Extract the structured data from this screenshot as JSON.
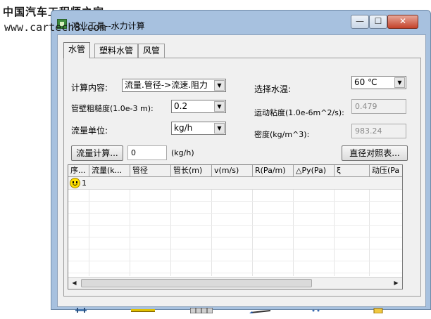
{
  "watermark": {
    "line1": "中国汽车工程师之家",
    "line2": "www.cartech8.com"
  },
  "window": {
    "title": "鸿业工具--水力计算",
    "controls": {
      "minimize": "—",
      "maximize": "☐",
      "close": "✕"
    }
  },
  "tabs": [
    {
      "label": "水管",
      "active": true
    },
    {
      "label": "塑料水管",
      "active": false
    },
    {
      "label": "风管",
      "active": false
    }
  ],
  "form": {
    "calc_content_label": "计算内容:",
    "calc_content_value": "流量.管径->流速.阻力",
    "roughness_label": "管壁粗糙度(1.0e-3 m):",
    "roughness_value": "0.2",
    "flow_unit_label": "流量单位:",
    "flow_unit_value": "kg/h",
    "water_temp_label": "选择水温:",
    "water_temp_value": "60 ℃",
    "viscosity_label": "运动粘度(1.0e-6m^2/s):",
    "viscosity_value": "0.479",
    "density_label": "密度(kg/m^3):",
    "density_value": "983.24",
    "flow_calc_button": "流量计算...",
    "flow_calc_value": "0",
    "flow_calc_unit": "(kg/h)",
    "diameter_table_button": "直径对照表..."
  },
  "grid": {
    "columns": [
      "序...",
      "流量(k...",
      "管径",
      "管长(m)",
      "v(m/s)",
      "R(Pa/m)",
      "△Py(Pa)",
      "ξ",
      "动压(Pa"
    ],
    "rows": [
      {
        "num": "1"
      }
    ]
  },
  "colors": {
    "window_frame": "#a7c1df",
    "client_bg": "#f0f0f0",
    "close_button": "#c4422a",
    "smiley": "#ffe000"
  },
  "icons": {
    "app": "app-icon",
    "row_status": "smiley-icon",
    "footer": [
      "pipe-tool-icon",
      "line-tool-icon",
      "table-tool-icon",
      "pen-tool-icon",
      "dots-icon",
      "folder-icon"
    ]
  }
}
